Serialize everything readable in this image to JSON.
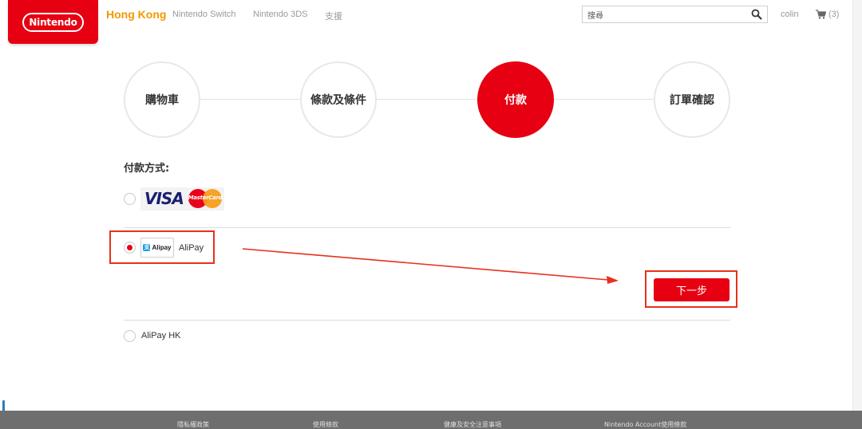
{
  "header": {
    "logo_text": "Nintendo",
    "region": "Hong Kong",
    "nav": {
      "switch": "Nintendo Switch",
      "ds3": "Nintendo 3DS",
      "support": "支援"
    },
    "search": {
      "value": "搜尋",
      "icon": "search-icon"
    },
    "username": "colin",
    "cart": {
      "icon": "cart-icon",
      "count": "(3)"
    }
  },
  "steps": [
    {
      "label": "購物車",
      "active": false
    },
    {
      "label": "條款及條件",
      "active": false
    },
    {
      "label": "付款",
      "active": true
    },
    {
      "label": "訂單確認",
      "active": false
    }
  ],
  "payment": {
    "title": "付款方式:",
    "methods": [
      {
        "id": "visa-mastercard",
        "logo_text": "VISA",
        "logo_text_2": "MasterCard",
        "selected": false
      },
      {
        "id": "alipay",
        "logo_text": "Alipay",
        "label": "AliPay",
        "selected": true
      },
      {
        "id": "alipay-hk",
        "label": "AliPay HK",
        "selected": false
      }
    ],
    "next_button": "下一步"
  },
  "colors": {
    "brand_red": "#e60012",
    "region_orange": "#f39800",
    "annotation_red": "#e8301e"
  },
  "footer": {
    "links": [
      "隱私權政策",
      "使用條款",
      "健康及安全注意事項",
      "Nintendo Account使用條款"
    ]
  }
}
